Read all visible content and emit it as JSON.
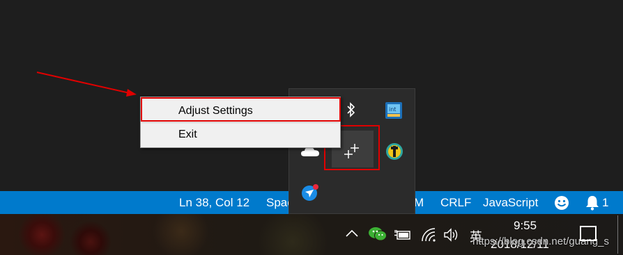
{
  "statusbar": {
    "position": "Ln 38, Col 12",
    "indent": "Spac",
    "encoding_tail": "M",
    "eol": "CRLF",
    "language": "JavaScript",
    "notifications_count": "1",
    "feedback_icon": "smiley-icon",
    "bell_icon": "bell-icon"
  },
  "context_menu": {
    "items": [
      {
        "label": "Adjust Settings"
      },
      {
        "label": "Exit"
      }
    ]
  },
  "tray_flyout": {
    "icons": [
      "bluetooth-icon",
      "intel-graphics-icon",
      "onedrive-icon",
      "crosshair-app-icon",
      "green-pin-app-icon",
      "messenger-app-icon"
    ]
  },
  "taskbar": {
    "ime": "英",
    "time": "9:55",
    "date": "2018/12/11",
    "icons": [
      "show-hidden-icons-chevron",
      "wechat-icon",
      "power-icon",
      "wifi-icon",
      "volume-icon",
      "ime-icon",
      "action-center-icon"
    ]
  },
  "watermark": "https://blog.csdn.net/guang_s",
  "colors": {
    "statusbar": "#007acc",
    "editor": "#1e1e1e",
    "annotation": "#e00000",
    "menu": "#f0f0f0"
  }
}
